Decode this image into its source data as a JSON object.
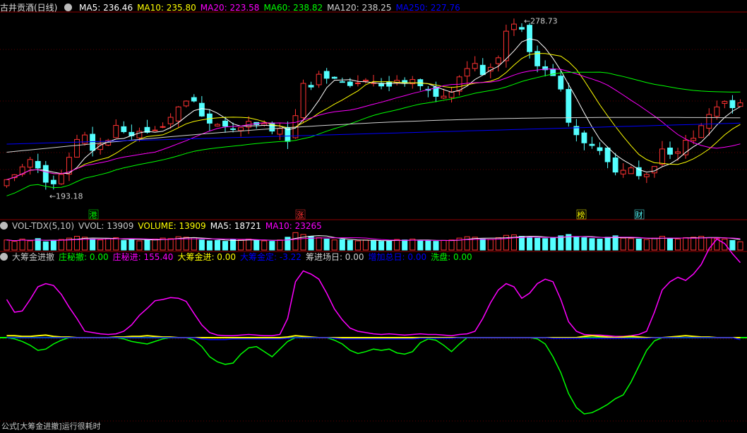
{
  "colors": {
    "bg": "#000000",
    "up": "#ff3232",
    "down": "#54ffff",
    "ma5": "#ffffff",
    "ma10": "#ffff00",
    "ma20": "#ff00ff",
    "ma60": "#00ff00",
    "ma120": "#d2d2d2",
    "ma250": "#0000ff",
    "separator": "#8b0000",
    "grid": "#5a0000",
    "zhuangchousan": "#00ff00",
    "zhuangchouwen": "#ff00ff",
    "dachoujinjin": "#ffff00",
    "dachoujinding": "#0000ff",
    "choujinchangri": "#d2d2d2",
    "zengjiazongri": "#0000ff",
    "xipan": "#00ff00"
  },
  "price_panel": {
    "title": "古井贡酒(日线)",
    "ma": [
      {
        "label": "MA5:",
        "value": "236.46",
        "color": "#ffffff"
      },
      {
        "label": "MA10:",
        "value": "235.80",
        "color": "#ffff00"
      },
      {
        "label": "MA20:",
        "value": "223.58",
        "color": "#ff00ff"
      },
      {
        "label": "MA60:",
        "value": "238.82",
        "color": "#00ff00"
      },
      {
        "label": "MA120:",
        "value": "238.25",
        "color": "#d2d2d2"
      },
      {
        "label": "MA250:",
        "value": "227.76",
        "color": "#0000ff"
      }
    ],
    "high_label": "278.73",
    "low_label": "193.18",
    "markers": [
      {
        "text": "港",
        "x": 132,
        "color": "#00ff00"
      },
      {
        "text": "涨",
        "x": 425,
        "color": "#ff3232"
      },
      {
        "text": "榜",
        "x": 823,
        "color": "#ffff00"
      },
      {
        "text": "财",
        "x": 905,
        "color": "#54ffff"
      }
    ]
  },
  "volume_panel": {
    "header": [
      {
        "text": "VOL-TDX(5,10)",
        "color": "#c8c8c8"
      },
      {
        "text": "VVOL: 13909",
        "color": "#c8c8c8"
      },
      {
        "text": "VOLUME: 13909",
        "color": "#ffff00"
      },
      {
        "text": "MA5: 18721",
        "color": "#ffffff"
      },
      {
        "text": "MA10: 23265",
        "color": "#ff00ff"
      }
    ]
  },
  "indicator_panel": {
    "header": [
      {
        "text": "大筹金进撤",
        "color": "#c8c8c8"
      },
      {
        "text": "庄秘撤: 0.00",
        "color": "#00ff00"
      },
      {
        "text": "庄秘进: 155.40",
        "color": "#ff00ff"
      },
      {
        "text": "大筹金进: 0.00",
        "color": "#ffff00"
      },
      {
        "text": "大筹金定: -3.22",
        "color": "#0000ff"
      },
      {
        "text": "筹进场日: 0.00",
        "color": "#d2d2d2"
      },
      {
        "text": "增加总日: 0.00",
        "color": "#0000ff"
      },
      {
        "text": "洗盘: 0.00",
        "color": "#00ff00"
      }
    ]
  },
  "footer": "公式[大筹金进撤]运行很耗时",
  "chart_data": [
    {
      "type": "candlestick",
      "name": "古井贡酒(日线)",
      "x": "day index 0-94",
      "ohlc_close": [
        200.5,
        202.9,
        206.8,
        210.4,
        206.2,
        199.2,
        198.4,
        203.1,
        211.5,
        220.3,
        222.5,
        214.9,
        217.9,
        219.8,
        227.2,
        224.1,
        222.1,
        224.3,
        223.8,
        224.9,
        226.6,
        231.2,
        236.3,
        239.2,
        239.2,
        231.8,
        228.3,
        227.7,
        226.8,
        225.3,
        226.1,
        229.2,
        227.6,
        228.1,
        224.4,
        225.7,
        219.3,
        232.0,
        247.9,
        246.1,
        252.4,
        250.4,
        250.4,
        248.6,
        246.8,
        248.1,
        249.5,
        248.2,
        246.6,
        246.5,
        249.4,
        248.3,
        249.8,
        246.7,
        244.5,
        241.5,
        241.6,
        243.6,
        251.1,
        255.2,
        257.7,
        252.2,
        255.8,
        260.5,
        273.6,
        277.1,
        274.6,
        263.5,
        256.5,
        254.6,
        251.7,
        245.1,
        228.7,
        222.6,
        218.6,
        217.3,
        214.8,
        209.3,
        204.2,
        205.1,
        206.3,
        202.4,
        203.1,
        207.0,
        215.6,
        213.0,
        214.2,
        219.9,
        220.9,
        227.1,
        232.6,
        236.3,
        239.0,
        235.9,
        238.3
      ],
      "price_range": [
        186,
        282
      ],
      "high_price": 278.73,
      "low_price": 193.18,
      "moving_averages": {
        "MA5": 236.46,
        "MA10": 235.8,
        "MA20": 223.58,
        "MA60": 238.82,
        "MA120": 238.25,
        "MA250": 227.76
      }
    },
    {
      "type": "bar",
      "name": "VOL-TDX(5,10)",
      "values": [
        22,
        19,
        24,
        20,
        25,
        18,
        21,
        23,
        26,
        30,
        28,
        24,
        22,
        25,
        27,
        21,
        23,
        20,
        22,
        24,
        26,
        25,
        29,
        28,
        27,
        22,
        20,
        21,
        19,
        23,
        22,
        24,
        21,
        20,
        19,
        22,
        28,
        38,
        34,
        30,
        27,
        24,
        22,
        23,
        21,
        20,
        22,
        21,
        19,
        20,
        23,
        22,
        24,
        21,
        20,
        19,
        21,
        22,
        26,
        29,
        28,
        24,
        23,
        27,
        32,
        33,
        30,
        28,
        26,
        25,
        27,
        31,
        34,
        29,
        27,
        25,
        24,
        28,
        31,
        26,
        25,
        24,
        23,
        26,
        30,
        25,
        24,
        27,
        28,
        30,
        27,
        25,
        24,
        21,
        18
      ],
      "VOLUME": 13909,
      "MA5": 18721,
      "MA10": 23265
    },
    {
      "type": "line",
      "name": "大筹金进撤",
      "series": [
        {
          "name": "庄秘进",
          "values": [
            60,
            40,
            42,
            60,
            80,
            85,
            82,
            68,
            48,
            30,
            10,
            8,
            6,
            5,
            6,
            10,
            20,
            35,
            46,
            58,
            60,
            63,
            62,
            57,
            38,
            20,
            8,
            4,
            3,
            3,
            4,
            5,
            4,
            3,
            3,
            5,
            30,
            88,
            105,
            100,
            92,
            70,
            45,
            28,
            15,
            10,
            8,
            6,
            5,
            6,
            5,
            4,
            5,
            6,
            5,
            5,
            4,
            3,
            5,
            6,
            10,
            30,
            55,
            75,
            85,
            80,
            62,
            70,
            85,
            92,
            88,
            60,
            25,
            10,
            5,
            4,
            4,
            3,
            2,
            2,
            3,
            5,
            10,
            40,
            75,
            88,
            95,
            90,
            100,
            115,
            140,
            155,
            148,
            132,
            118
          ]
        },
        {
          "name": "庄秘撤",
          "values": [
            0,
            -2,
            -6,
            -12,
            -20,
            -18,
            -10,
            -4,
            0,
            0,
            0,
            0,
            0,
            0,
            0,
            -2,
            -6,
            -8,
            -10,
            -6,
            -2,
            0,
            0,
            0,
            -4,
            -14,
            -30,
            -38,
            -42,
            -40,
            -26,
            -16,
            -14,
            -22,
            -30,
            -18,
            -6,
            0,
            0,
            0,
            0,
            0,
            -4,
            -10,
            -20,
            -25,
            -22,
            -18,
            -20,
            -18,
            -24,
            -26,
            -22,
            -8,
            -2,
            -4,
            -12,
            -22,
            -10,
            0,
            0,
            0,
            0,
            0,
            0,
            0,
            0,
            0,
            -2,
            -10,
            -30,
            -55,
            -88,
            -110,
            -120,
            -118,
            -112,
            -105,
            -96,
            -90,
            -70,
            -45,
            -20,
            -5,
            0,
            0,
            0,
            0,
            0,
            0,
            0,
            0,
            0,
            0,
            0
          ]
        },
        {
          "name": "大筹金进",
          "values": [
            3,
            3,
            2,
            2,
            3,
            4,
            2,
            1,
            1,
            0,
            0,
            0,
            0,
            0,
            1,
            1,
            2,
            2,
            3,
            2,
            1,
            1,
            0,
            0,
            0,
            0,
            0,
            0,
            0,
            0,
            0,
            0,
            0,
            0,
            0,
            0,
            1,
            3,
            2,
            1,
            0,
            0,
            0,
            0,
            0,
            0,
            0,
            0,
            0,
            0,
            0,
            0,
            0,
            0,
            0,
            0,
            0,
            0,
            0,
            0,
            0,
            0,
            0,
            0,
            0,
            0,
            0,
            0,
            0,
            0,
            0,
            0,
            0,
            0,
            2,
            3,
            2,
            1,
            0,
            1,
            2,
            1,
            0,
            0,
            0,
            1,
            2,
            3,
            2,
            1,
            1,
            0,
            0,
            0,
            0
          ]
        },
        {
          "name": "大筹金定",
          "values": [
            0,
            0,
            0,
            0,
            0,
            0,
            0,
            0,
            0,
            0,
            0,
            0,
            0,
            0,
            0,
            0,
            0,
            0,
            0,
            0,
            0,
            0,
            0,
            0,
            0,
            -2,
            -3,
            -3,
            -3,
            -2,
            -2,
            -2,
            -2,
            -2,
            -2,
            -2,
            -1,
            0,
            0,
            0,
            0,
            0,
            -1,
            -2,
            -2,
            -2,
            -2,
            -2,
            -2,
            -2,
            -2,
            -2,
            -2,
            -1,
            -1,
            -1,
            -1,
            -1,
            0,
            0,
            0,
            0,
            0,
            0,
            0,
            0,
            0,
            0,
            0,
            0,
            -1,
            -1,
            -1,
            -1,
            -1,
            -1,
            -1,
            -1,
            -1,
            -1,
            -1,
            -1,
            -1,
            0,
            0,
            0,
            0,
            0,
            0,
            0,
            0,
            0,
            0,
            0,
            -3.22
          ]
        }
      ]
    }
  ]
}
